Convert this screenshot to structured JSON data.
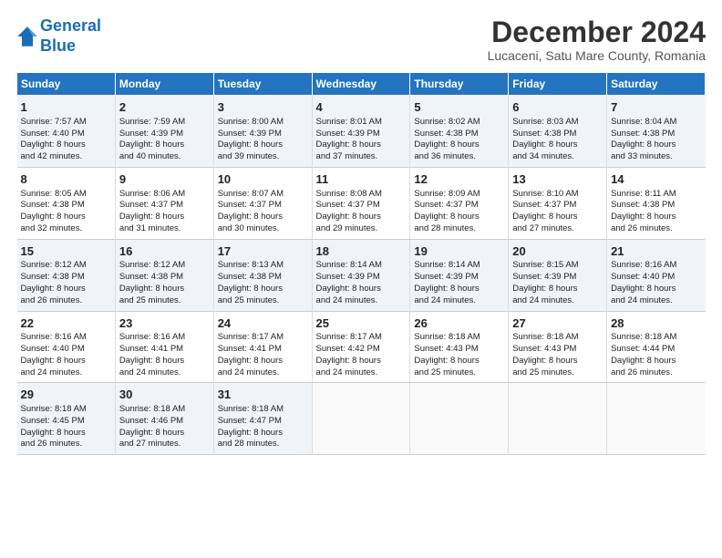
{
  "header": {
    "logo_line1": "General",
    "logo_line2": "Blue",
    "month": "December 2024",
    "location": "Lucaceni, Satu Mare County, Romania"
  },
  "days_of_week": [
    "Sunday",
    "Monday",
    "Tuesday",
    "Wednesday",
    "Thursday",
    "Friday",
    "Saturday"
  ],
  "weeks": [
    [
      {
        "day": "1",
        "lines": [
          "Sunrise: 7:57 AM",
          "Sunset: 4:40 PM",
          "Daylight: 8 hours",
          "and 42 minutes."
        ]
      },
      {
        "day": "2",
        "lines": [
          "Sunrise: 7:59 AM",
          "Sunset: 4:39 PM",
          "Daylight: 8 hours",
          "and 40 minutes."
        ]
      },
      {
        "day": "3",
        "lines": [
          "Sunrise: 8:00 AM",
          "Sunset: 4:39 PM",
          "Daylight: 8 hours",
          "and 39 minutes."
        ]
      },
      {
        "day": "4",
        "lines": [
          "Sunrise: 8:01 AM",
          "Sunset: 4:39 PM",
          "Daylight: 8 hours",
          "and 37 minutes."
        ]
      },
      {
        "day": "5",
        "lines": [
          "Sunrise: 8:02 AM",
          "Sunset: 4:38 PM",
          "Daylight: 8 hours",
          "and 36 minutes."
        ]
      },
      {
        "day": "6",
        "lines": [
          "Sunrise: 8:03 AM",
          "Sunset: 4:38 PM",
          "Daylight: 8 hours",
          "and 34 minutes."
        ]
      },
      {
        "day": "7",
        "lines": [
          "Sunrise: 8:04 AM",
          "Sunset: 4:38 PM",
          "Daylight: 8 hours",
          "and 33 minutes."
        ]
      }
    ],
    [
      {
        "day": "8",
        "lines": [
          "Sunrise: 8:05 AM",
          "Sunset: 4:38 PM",
          "Daylight: 8 hours",
          "and 32 minutes."
        ]
      },
      {
        "day": "9",
        "lines": [
          "Sunrise: 8:06 AM",
          "Sunset: 4:37 PM",
          "Daylight: 8 hours",
          "and 31 minutes."
        ]
      },
      {
        "day": "10",
        "lines": [
          "Sunrise: 8:07 AM",
          "Sunset: 4:37 PM",
          "Daylight: 8 hours",
          "and 30 minutes."
        ]
      },
      {
        "day": "11",
        "lines": [
          "Sunrise: 8:08 AM",
          "Sunset: 4:37 PM",
          "Daylight: 8 hours",
          "and 29 minutes."
        ]
      },
      {
        "day": "12",
        "lines": [
          "Sunrise: 8:09 AM",
          "Sunset: 4:37 PM",
          "Daylight: 8 hours",
          "and 28 minutes."
        ]
      },
      {
        "day": "13",
        "lines": [
          "Sunrise: 8:10 AM",
          "Sunset: 4:37 PM",
          "Daylight: 8 hours",
          "and 27 minutes."
        ]
      },
      {
        "day": "14",
        "lines": [
          "Sunrise: 8:11 AM",
          "Sunset: 4:38 PM",
          "Daylight: 8 hours",
          "and 26 minutes."
        ]
      }
    ],
    [
      {
        "day": "15",
        "lines": [
          "Sunrise: 8:12 AM",
          "Sunset: 4:38 PM",
          "Daylight: 8 hours",
          "and 26 minutes."
        ]
      },
      {
        "day": "16",
        "lines": [
          "Sunrise: 8:12 AM",
          "Sunset: 4:38 PM",
          "Daylight: 8 hours",
          "and 25 minutes."
        ]
      },
      {
        "day": "17",
        "lines": [
          "Sunrise: 8:13 AM",
          "Sunset: 4:38 PM",
          "Daylight: 8 hours",
          "and 25 minutes."
        ]
      },
      {
        "day": "18",
        "lines": [
          "Sunrise: 8:14 AM",
          "Sunset: 4:39 PM",
          "Daylight: 8 hours",
          "and 24 minutes."
        ]
      },
      {
        "day": "19",
        "lines": [
          "Sunrise: 8:14 AM",
          "Sunset: 4:39 PM",
          "Daylight: 8 hours",
          "and 24 minutes."
        ]
      },
      {
        "day": "20",
        "lines": [
          "Sunrise: 8:15 AM",
          "Sunset: 4:39 PM",
          "Daylight: 8 hours",
          "and 24 minutes."
        ]
      },
      {
        "day": "21",
        "lines": [
          "Sunrise: 8:16 AM",
          "Sunset: 4:40 PM",
          "Daylight: 8 hours",
          "and 24 minutes."
        ]
      }
    ],
    [
      {
        "day": "22",
        "lines": [
          "Sunrise: 8:16 AM",
          "Sunset: 4:40 PM",
          "Daylight: 8 hours",
          "and 24 minutes."
        ]
      },
      {
        "day": "23",
        "lines": [
          "Sunrise: 8:16 AM",
          "Sunset: 4:41 PM",
          "Daylight: 8 hours",
          "and 24 minutes."
        ]
      },
      {
        "day": "24",
        "lines": [
          "Sunrise: 8:17 AM",
          "Sunset: 4:41 PM",
          "Daylight: 8 hours",
          "and 24 minutes."
        ]
      },
      {
        "day": "25",
        "lines": [
          "Sunrise: 8:17 AM",
          "Sunset: 4:42 PM",
          "Daylight: 8 hours",
          "and 24 minutes."
        ]
      },
      {
        "day": "26",
        "lines": [
          "Sunrise: 8:18 AM",
          "Sunset: 4:43 PM",
          "Daylight: 8 hours",
          "and 25 minutes."
        ]
      },
      {
        "day": "27",
        "lines": [
          "Sunrise: 8:18 AM",
          "Sunset: 4:43 PM",
          "Daylight: 8 hours",
          "and 25 minutes."
        ]
      },
      {
        "day": "28",
        "lines": [
          "Sunrise: 8:18 AM",
          "Sunset: 4:44 PM",
          "Daylight: 8 hours",
          "and 26 minutes."
        ]
      }
    ],
    [
      {
        "day": "29",
        "lines": [
          "Sunrise: 8:18 AM",
          "Sunset: 4:45 PM",
          "Daylight: 8 hours",
          "and 26 minutes."
        ]
      },
      {
        "day": "30",
        "lines": [
          "Sunrise: 8:18 AM",
          "Sunset: 4:46 PM",
          "Daylight: 8 hours",
          "and 27 minutes."
        ]
      },
      {
        "day": "31",
        "lines": [
          "Sunrise: 8:18 AM",
          "Sunset: 4:47 PM",
          "Daylight: 8 hours",
          "and 28 minutes."
        ]
      },
      null,
      null,
      null,
      null
    ]
  ]
}
